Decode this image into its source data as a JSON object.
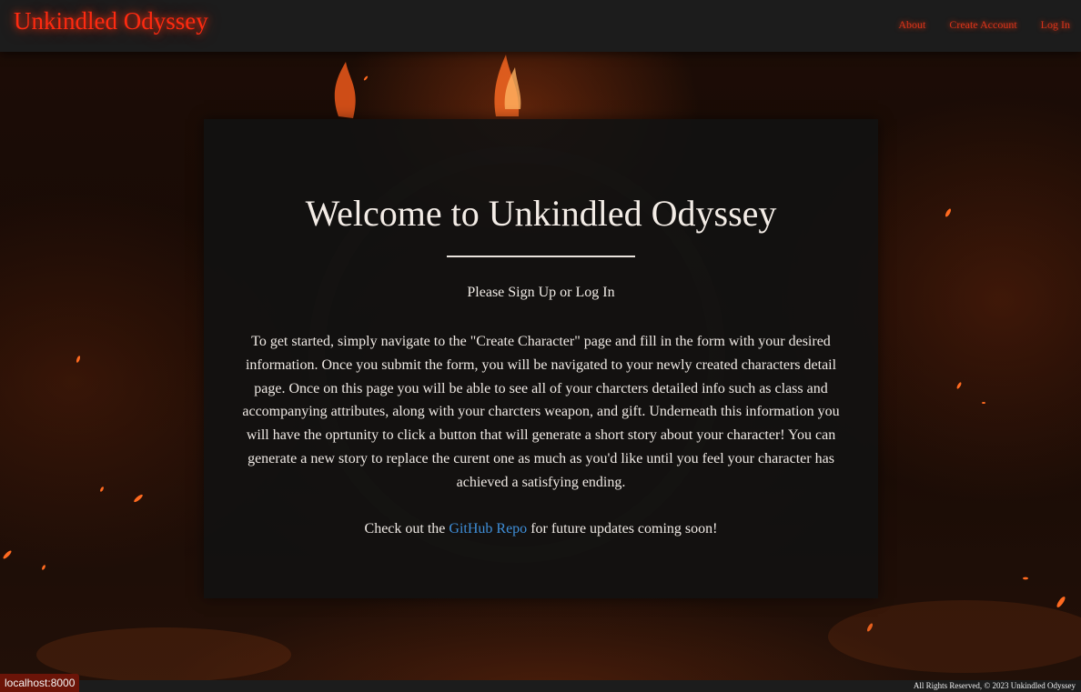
{
  "header": {
    "brand": "Unkindled Odyssey",
    "nav": [
      {
        "label": "About"
      },
      {
        "label": "Create Account"
      },
      {
        "label": "Log In"
      }
    ]
  },
  "main": {
    "title": "Welcome to Unkindled Odyssey",
    "subtitle": "Please Sign Up or Log In",
    "body": "To get started, simply navigate to the \"Create Character\" page and fill in the form with your desired information. Once you submit the form, you will be navigated to your newly created characters detail page. Once on this page you will be able to see all of your charcters detailed info such as class and accompanying attributes, along with your charcters weapon, and gift. Underneath this information you will have the oprtunity to click a button that will generate a short story about your character! You can generate a new story to replace the curent one as much as you'd like until you feel your character has achieved a satisfying ending.",
    "cta_prefix": "Check out the ",
    "cta_link": "GitHub Repo",
    "cta_suffix": " for future updates coming soon!"
  },
  "footer": {
    "text": "All Rights Reserved, © 2023 Unkindled Odyssey"
  },
  "browser": {
    "status_url": "localhost:8000"
  },
  "colors": {
    "brand": "#ff2a10",
    "link": "#3f8fd9",
    "card_bg": "#121212",
    "navbar_bg": "#1c1c1c"
  }
}
